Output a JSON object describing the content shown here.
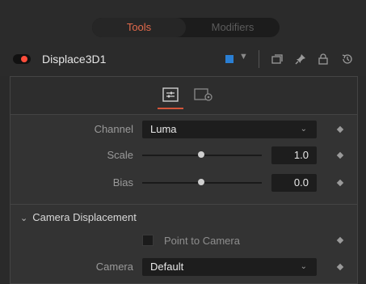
{
  "top_tabs": {
    "tools": "Tools",
    "modifiers": "Modifiers",
    "active": "tools"
  },
  "node": {
    "name": "Displace3D1",
    "enabled": true,
    "color": "#2a7fd4",
    "icons": [
      "version-icon",
      "pin-icon",
      "lock-icon",
      "reset-icon"
    ]
  },
  "control_tabs": [
    {
      "icon": "controls-icon",
      "active": true
    },
    {
      "icon": "settings-icon",
      "active": false
    }
  ],
  "fields": {
    "channel": {
      "label": "Channel",
      "value": "Luma"
    },
    "scale": {
      "label": "Scale",
      "value": "1.0"
    },
    "bias": {
      "label": "Bias",
      "value": "0.0"
    }
  },
  "camera_section": {
    "title": "Camera Displacement",
    "point_to_camera": {
      "label": "Point to Camera",
      "checked": false
    },
    "camera": {
      "label": "Camera",
      "value": "Default"
    }
  },
  "colors": {
    "accent_tab": "#e26a4b",
    "active_underline": "#d4553a",
    "panel": "#333333"
  }
}
